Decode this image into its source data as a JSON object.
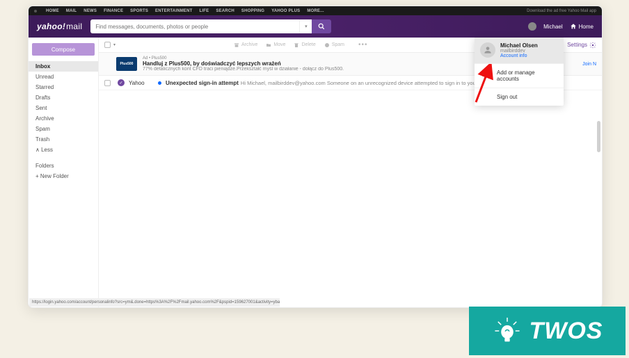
{
  "topbar": {
    "links": [
      "HOME",
      "MAIL",
      "NEWS",
      "FINANCE",
      "SPORTS",
      "ENTERTAINMENT",
      "LIFE",
      "SEARCH",
      "SHOPPING",
      "YAHOO PLUS",
      "MORE..."
    ],
    "promo": "Download the ad free Yahoo Mail app"
  },
  "header": {
    "logo_brand": "yahoo!",
    "logo_product": "mail",
    "search_placeholder": "Find messages, documents, photos or people",
    "user_name": "Michael",
    "home_label": "Home"
  },
  "sidebar": {
    "compose_label": "Compose",
    "folders": [
      "Inbox",
      "Unread",
      "Starred",
      "Drafts",
      "Sent",
      "Archive",
      "Spam",
      "Trash"
    ],
    "less_label": "∧ Less",
    "folders_title": "Folders",
    "new_folder_label": "+ New Folder"
  },
  "toolbar": {
    "archive_label": "Archive",
    "move_label": "Move",
    "delete_label": "Delete",
    "spam_label": "Spam",
    "settings_label": "Settings"
  },
  "ad": {
    "logo_text": "Plus500",
    "label": "Ad • Plus500",
    "title": "Handluj z Plus500, by doświadczyć lepszych wrażeń",
    "desc": "77% detalicznych kont CFD traci pieniądze.Przekształć myśl w działanie - dołącz do Plus500.",
    "cta": "Join N"
  },
  "emails": [
    {
      "sender": "Yahoo",
      "subject": "Unexpected sign-in attempt",
      "preview": "Hi Michael, mailbirddev@yahoo.com Someone on an unrecognized device attempted to sign in to your Yahoo acc..."
    }
  ],
  "account_menu": {
    "name": "Michael Olsen",
    "email": "mailbirddev",
    "account_info": "Account info",
    "add_label": "Add or manage accounts",
    "signout_label": "Sign out"
  },
  "status_url": "https://login.yahoo.com/account/personalinfo?src=ym&.done=https%3A%2F%2Fmail.yahoo.com%2F&pspid=159627001&activity=ybar-acctinfo",
  "badge": {
    "text": "TWOS"
  }
}
